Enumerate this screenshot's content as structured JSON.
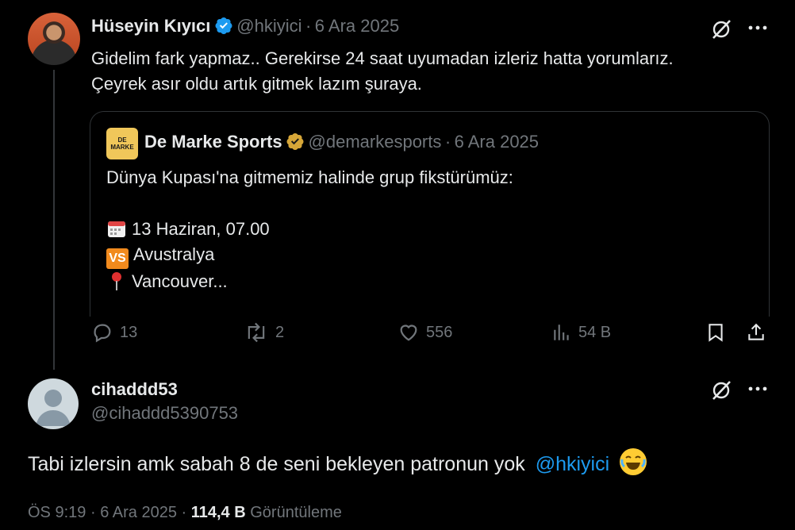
{
  "tweet1": {
    "author_name": "Hüseyin Kıyıcı",
    "handle": "@hkiyici",
    "separator": "·",
    "date": "6 Ara 2025",
    "text_line1": "Gidelim fark yapmaz.. Gerekirse 24 saat uyumadan izleriz hatta yorumlarız.",
    "text_line2": "Çeyrek asır oldu artık gitmek lazım şuraya.",
    "quote": {
      "logo_text": "DE MARKE",
      "author_name": "De Marke Sports",
      "handle": "@demarkesports",
      "separator": "·",
      "date": "6 Ara 2025",
      "line1": "Dünya Kupası'na gitmemiz halinde grup fikstürümüz:",
      "line2": "13 Haziran, 07.00",
      "line3": "Avustralya",
      "line4": "Vancouver...",
      "vs_badge": "VS"
    },
    "actions": {
      "replies": "13",
      "reposts": "2",
      "likes": "556",
      "views": "54 B"
    }
  },
  "tweet2": {
    "author_name": "cihaddd53",
    "handle": "@cihaddd5390753",
    "text": "Tabi izlersin amk sabah 8 de seni bekleyen patronun yok",
    "mention": "@hkiyici",
    "time": "ÖS 9:19",
    "separator": "·",
    "date": "6 Ara 2025",
    "separator2": "·",
    "views_count": "114,4 B",
    "views_label": "Görüntüleme"
  },
  "colors": {
    "background": "#000000",
    "text": "#e7e9ea",
    "muted": "#71767b",
    "accent": "#1d9bf0",
    "border": "#2f3336"
  },
  "icons": [
    "grok-icon",
    "more-icon",
    "verified-icon",
    "gold-verified-icon",
    "reply-icon",
    "repost-icon",
    "like-icon",
    "views-icon",
    "bookmark-icon",
    "share-icon",
    "calendar-icon",
    "vs-icon",
    "pin-icon",
    "laughing-emoji"
  ]
}
